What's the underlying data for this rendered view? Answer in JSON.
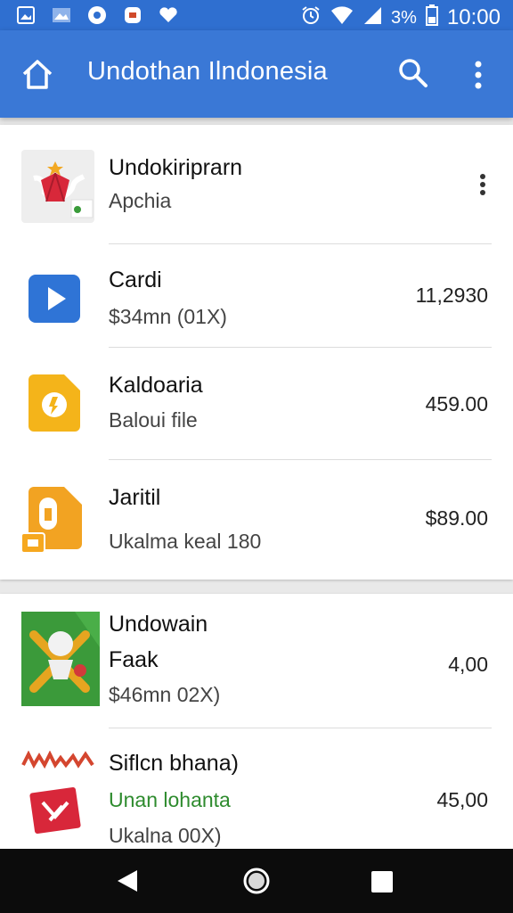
{
  "status_bar": {
    "battery_percent": "3%",
    "time": "10:00",
    "icons": [
      "gallery-icon",
      "image-icon",
      "circle-app-icon",
      "shield-icon",
      "heart-icon",
      "alarm-icon",
      "wifi-icon",
      "signal-icon",
      "battery-icon"
    ]
  },
  "app_bar": {
    "title": "Undothan Ilndonesia",
    "icons": [
      "home-icon",
      "search-icon",
      "more-vert-icon"
    ]
  },
  "list1": [
    {
      "title": "Undokiriprarn",
      "subtitle": "Apchia",
      "price": "",
      "icon": "red-shield-app-icon",
      "has_menu": true
    },
    {
      "title": "Cardi",
      "subtitle": "$34mn (01X)",
      "price": "11,2930",
      "icon": "blue-play-icon"
    },
    {
      "title": "Kaldoaria",
      "subtitle": "Baloui file",
      "price": "459.00",
      "icon": "yellow-doc-icon"
    },
    {
      "title": "Jaritil",
      "subtitle": "Ukalma keal 180",
      "price": "$89.00",
      "icon": "orange-file-icon"
    }
  ],
  "list2": [
    {
      "title": "Undowain",
      "line2": "Faak",
      "subtitle": "$46mn 02X)",
      "price": "4,00",
      "icon": "green-map-icon"
    },
    {
      "title": "Siflcn bhana)",
      "line2": "Unan lohanta",
      "subtitle": "Ukalna 00X)",
      "price": "45,00",
      "icon": "red-tag-icon"
    }
  ],
  "nav": {
    "icons": [
      "back-icon",
      "home-nav-icon",
      "recent-apps-icon"
    ]
  },
  "colors": {
    "primary": "#3a78d6",
    "accent_green": "#2e8b2e"
  }
}
